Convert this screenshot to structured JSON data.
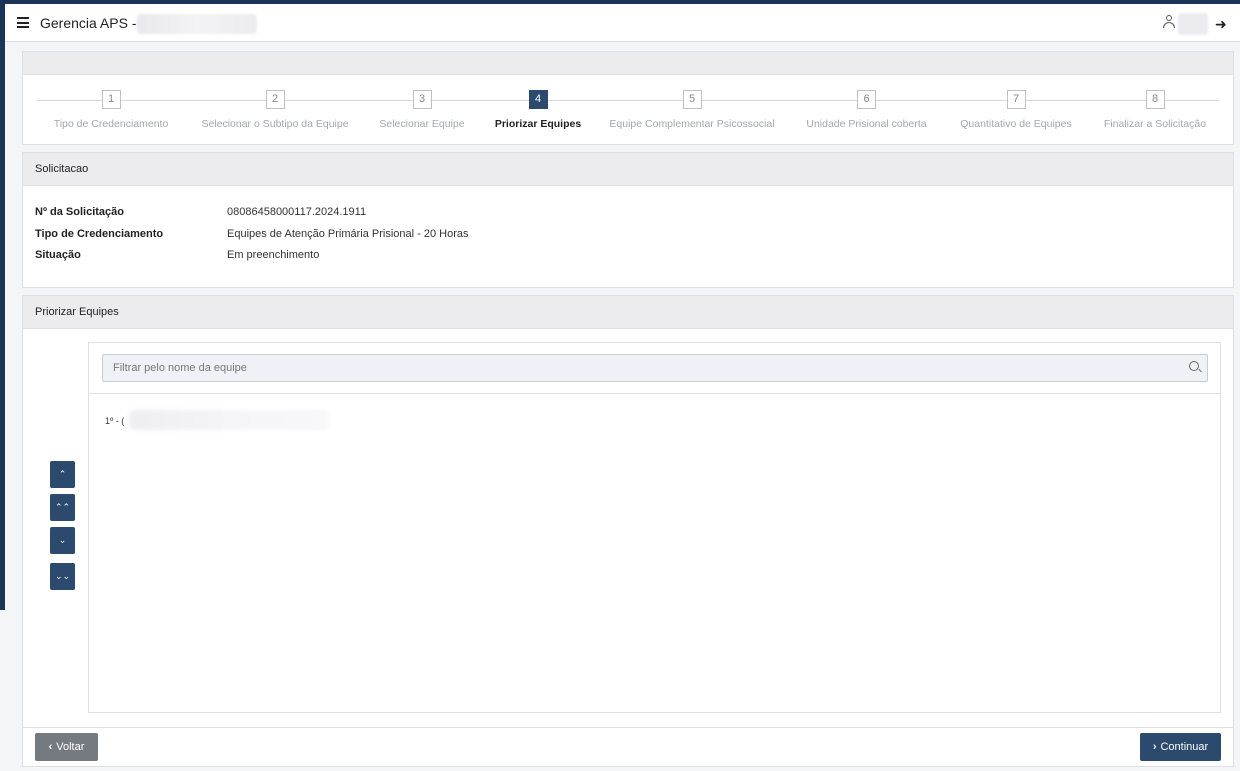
{
  "header": {
    "title": "Gerencia APS -",
    "menu_icon": "menu-icon",
    "user_icon": "user-icon",
    "logout_icon": "logout-icon",
    "logout_glyph": "➜"
  },
  "stepper": {
    "active_index": 3,
    "steps": [
      {
        "num": "1",
        "label": "Tipo de Credenciamento"
      },
      {
        "num": "2",
        "label": "Selecionar o Subtipo da Equipe"
      },
      {
        "num": "3",
        "label": "Selecionar Equipe"
      },
      {
        "num": "4",
        "label": "Priorizar Equipes"
      },
      {
        "num": "5",
        "label": "Equipe Complementar Psicossocial"
      },
      {
        "num": "6",
        "label": "Unidade Prisional coberta"
      },
      {
        "num": "7",
        "label": "Quantitativo de Equipes"
      },
      {
        "num": "8",
        "label": "Finalizar a Solicitação"
      }
    ]
  },
  "solicitacao": {
    "title": "Solicitacao",
    "fields": [
      {
        "key": "Nº da Solicitação",
        "value": "08086458000117.2024.1911"
      },
      {
        "key": "Tipo de Credenciamento",
        "value": "Equipes de Atenção Primária Prisional - 20 Horas"
      },
      {
        "key": "Situação",
        "value": "Em preenchimento"
      }
    ]
  },
  "priorizar": {
    "title": "Priorizar Equipes",
    "search_placeholder": "Filtrar pelo nome da equipe",
    "items": [
      "1º - ("
    ],
    "move_buttons": [
      {
        "name": "move-up-button",
        "glyph": "⌃"
      },
      {
        "name": "move-top-button",
        "glyph": "⌃⌃"
      },
      {
        "name": "move-down-button",
        "glyph": "⌄"
      },
      {
        "name": "move-bottom-button",
        "glyph": "⌄⌄"
      }
    ]
  },
  "footer": {
    "back_label": "Voltar",
    "back_chevron": "‹",
    "continue_label": "Continuar",
    "continue_chevron": "›"
  },
  "colors": {
    "primary": "#2c4a6e",
    "secondary": "#747a80",
    "top_bar": "#1c3557"
  }
}
